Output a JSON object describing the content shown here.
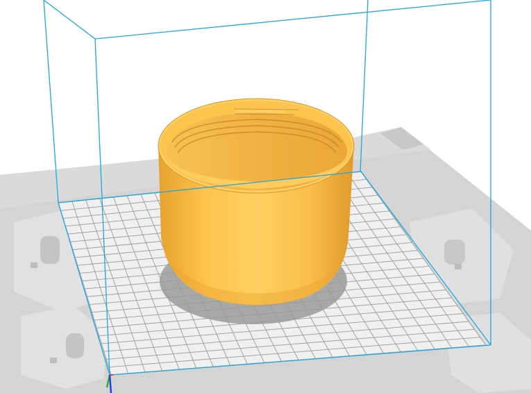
{
  "viewport": {
    "name": "3d-viewport",
    "background": "#ffffff",
    "colors": {
      "machine_base": "#d4d4d4",
      "machine_shade": "#c4c4c4",
      "machine_light": "#e2e2e2",
      "build_plate": "#f0f0f0",
      "grid_line": "#9a9a9a",
      "volume_edge": "#1ea6dd",
      "model_body": "#ffc44e",
      "model_dark": "#e9a430",
      "model_inner": "#f2b445",
      "shadow": "#9b9b9b",
      "axis_x": "#e33b2e",
      "axis_y": "#2bb32b",
      "axis_z": "#2741d6"
    },
    "objects": [
      {
        "name": "build-volume",
        "icon": "wireframe-cube"
      },
      {
        "name": "build-plate",
        "icon": "grid-plane"
      },
      {
        "name": "printed-model",
        "icon": "threaded-cap"
      },
      {
        "name": "axis-indicator",
        "icon": "xyz-axes"
      }
    ]
  }
}
